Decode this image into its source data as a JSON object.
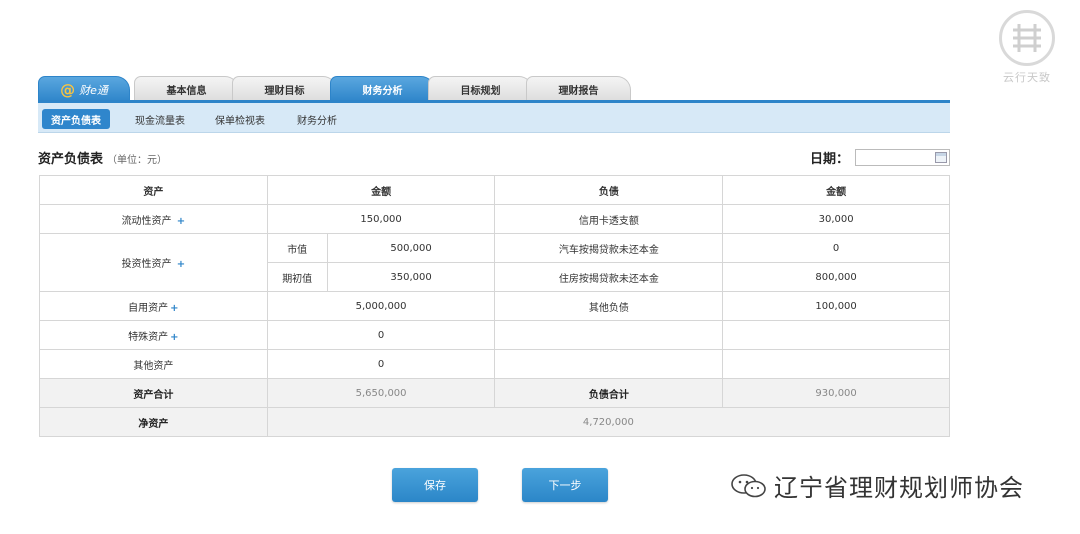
{
  "seal": {
    "caption": "云行天致"
  },
  "tabs": {
    "logo": {
      "at": "@",
      "label": "财e通"
    },
    "items": [
      "基本信息",
      "理财目标",
      "财务分析",
      "目标规划",
      "理财报告"
    ],
    "active": "财务分析"
  },
  "subtabs": {
    "items": [
      "资产负债表",
      "现金流量表",
      "保单检视表",
      "财务分析"
    ]
  },
  "page": {
    "title": "资产负债表",
    "unit": "（单位：元）",
    "date_label": "日期：",
    "date_value": ""
  },
  "table": {
    "headers": [
      "资产",
      "金额",
      "负债",
      "金额"
    ],
    "rows": {
      "liquid": {
        "label": "流动性资产",
        "value": "150,000",
        "liab": "信用卡透支额",
        "liab_value": "30,000"
      },
      "invest": {
        "label": "投资性资产",
        "market_label": "市值",
        "market_value": "500,000",
        "initial_label": "期初值",
        "initial_value": "350,000",
        "liab1": "汽车按揭贷款未还本金",
        "liab1_value": "0",
        "liab2": "住房按揭贷款未还本金",
        "liab2_value": "800,000"
      },
      "own": {
        "label": "自用资产",
        "value": "5,000,000",
        "liab": "其他负债",
        "liab_value": "100,000"
      },
      "special": {
        "label": "特殊资产",
        "value": "0"
      },
      "other": {
        "label": "其他资产",
        "value": "0"
      },
      "total": {
        "label": "资产合计",
        "value": "5,650,000",
        "liab": "负债合计",
        "liab_value": "930,000"
      },
      "net": {
        "label": "净资产",
        "value": "4,720,000"
      }
    },
    "plus": "+"
  },
  "buttons": {
    "save": "保存",
    "next": "下一步"
  },
  "watermark": {
    "text": "辽宁省理财规划师协会"
  }
}
